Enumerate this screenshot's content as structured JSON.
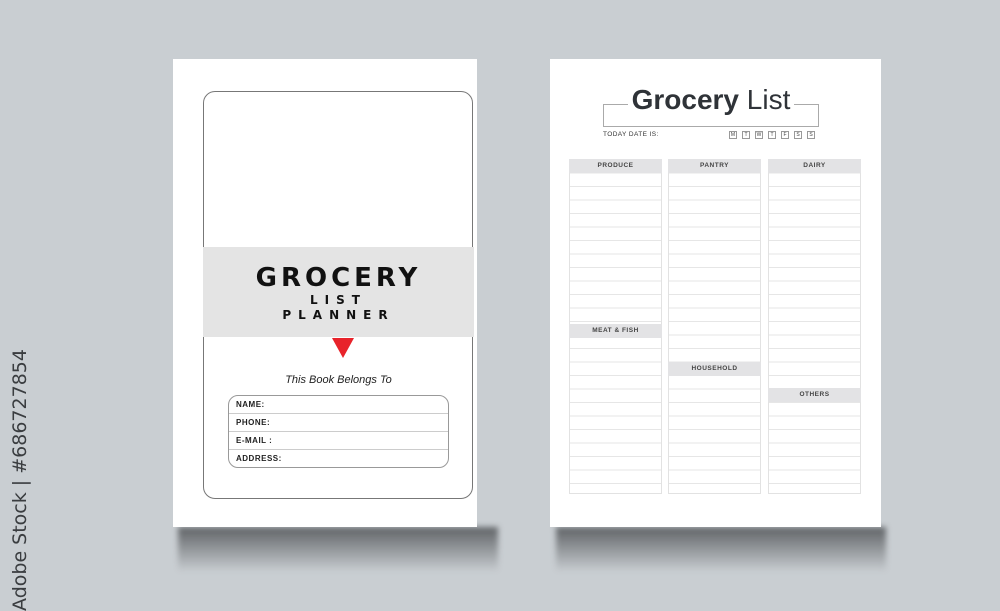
{
  "watermark": "Adobe Stock | #686727854",
  "cover_page": {
    "title_line1": "GROCERY",
    "title_line2": "LIST",
    "title_line3": "PLANNER",
    "accent_color": "#e8232a",
    "belongs_to": "This Book Belongs To",
    "fields": [
      "NAME:",
      "PHONE:",
      "E-MAIL :",
      "ADDRESS:"
    ]
  },
  "list_page": {
    "title_bold": "Grocery",
    "title_light": "List",
    "date_label": "TODAY DATE IS:",
    "days": [
      "M",
      "T",
      "W",
      "T",
      "F",
      "S",
      "S"
    ],
    "sections": {
      "produce": "PRODUCE",
      "pantry": "PANTRY",
      "dairy": "DAIRY",
      "meat_fish": "MEAT & FISH",
      "household": "HOUSEHOLD",
      "others": "OTHERS"
    }
  }
}
